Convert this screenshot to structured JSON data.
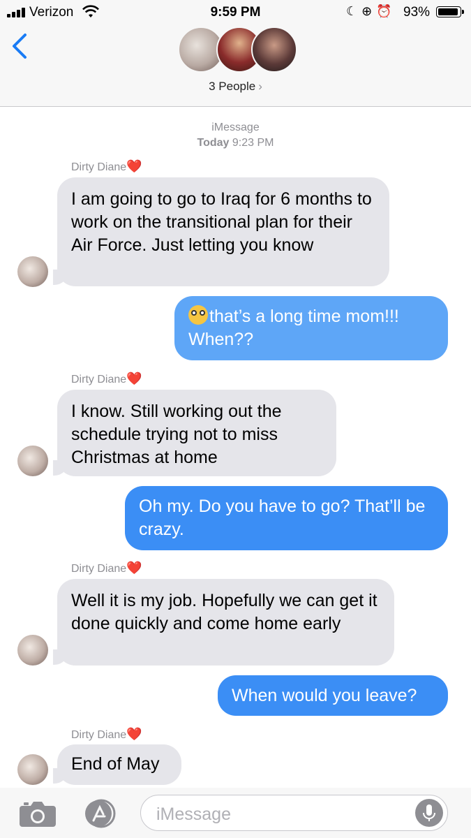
{
  "status_bar": {
    "carrier": "Verizon",
    "time": "9:59 PM",
    "battery": "93%",
    "battery_level": 0.93
  },
  "header": {
    "people_label": "3 People"
  },
  "thread_meta": {
    "service": "iMessage",
    "day": "Today",
    "time": "9:23 PM"
  },
  "messages": [
    {
      "direction": "incoming",
      "sender": "Dirty Diane",
      "text": "I am going to go to Iraq for 6 months to work on the transitional plan for their Air Force. Just letting you know"
    },
    {
      "direction": "outgoing",
      "emoji": "flushed-face",
      "text": "that’s a long time mom!!! When??"
    },
    {
      "direction": "incoming",
      "sender": "Dirty Diane",
      "text": "I know.   Still working out the schedule trying not to miss Christmas at home"
    },
    {
      "direction": "outgoing",
      "text": "Oh my. Do you have to go? That’ll be crazy."
    },
    {
      "direction": "incoming",
      "sender": "Dirty Diane",
      "text": "Well it is my job. Hopefully we can get it done quickly and come home early"
    },
    {
      "direction": "outgoing",
      "text": "When would you leave?"
    },
    {
      "direction": "incoming",
      "sender": "Dirty Diane",
      "text": "End of May"
    }
  ],
  "input": {
    "placeholder": "iMessage",
    "value": ""
  },
  "colors": {
    "outgoing_bubble": "#3b8ef5",
    "incoming_bubble": "#e5e5ea",
    "accent": "#1a7cf5"
  }
}
